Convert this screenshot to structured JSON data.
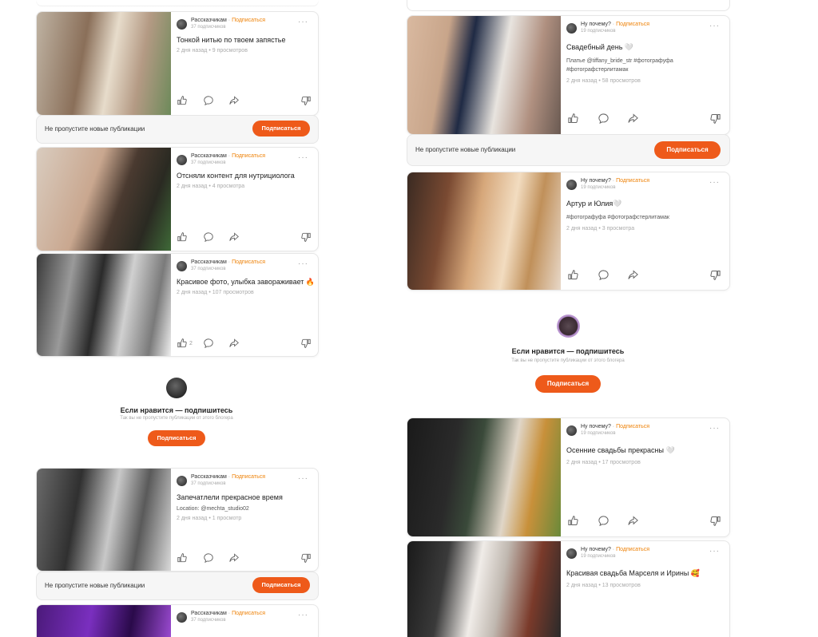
{
  "colors": {
    "accent": "#ee5a1a",
    "subscribe_text": "#ee8208"
  },
  "common": {
    "subscribe": "Подписаться",
    "bar_text": "Не пропустите новые публикации",
    "promo_title": "Если нравится — подпишитесь",
    "promo_subtitle": "Так вы не пропустите публикации от этого блогера",
    "dot": " · "
  },
  "left": {
    "author": "Рассказчикам",
    "subs": "37 подписчиков",
    "posts": [
      {
        "title": "Тонкой нитью по твоем запястье",
        "meta": "2 дня назад • 9 просмотров",
        "likes": ""
      },
      {
        "title": "Отсняли контент для нутрициолога",
        "meta": "2 дня назад • 4 просмотра",
        "likes": ""
      },
      {
        "title": "Красивое фото, улыбка завораживает 🔥",
        "meta": "2 дня назад • 107 просмотров",
        "likes": "2"
      },
      {
        "title": "Запечатлели прекрасное время",
        "tags": "Location: @mechta_studio02",
        "meta": "2 дня назад • 1 просмотр",
        "likes": ""
      },
      {
        "title": "",
        "meta": "",
        "likes": ""
      }
    ]
  },
  "right": {
    "author": "Ну почему?",
    "subs": "19 подписчиков",
    "posts": [
      {
        "title": "Свадебный день 🤍",
        "tags": "Платье @tiffany_bride_str #фотографуфа #фотографстерлитамак",
        "meta": "2 дня назад • 58 просмотров"
      },
      {
        "title": "Артур и Юлия🤍",
        "tags": "#фотографуфа #фотографстерлитамак",
        "meta": "2 дня назад • 3 просмотра"
      },
      {
        "title": "Осенние свадьбы прекрасны 🤍",
        "meta": "2 дня назад • 17 просмотров"
      },
      {
        "title": "Красивая свадьба Марселя и Ирины 🥰",
        "meta": "2 дня назад • 13 просмотров"
      }
    ]
  }
}
